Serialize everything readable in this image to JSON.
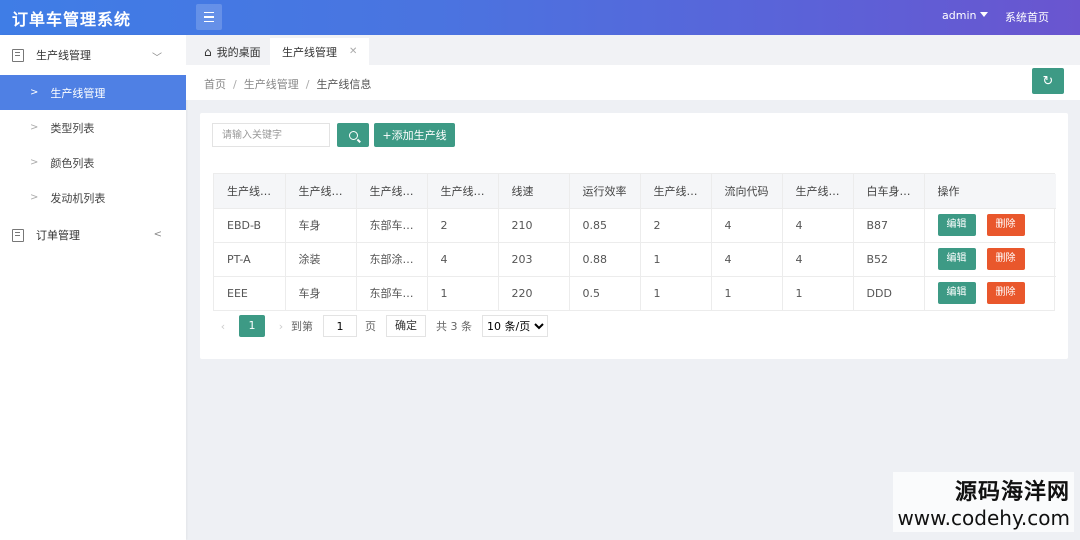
{
  "app": {
    "title": "订单车管理系统"
  },
  "header": {
    "user": "admin",
    "home_link": "系统首页"
  },
  "sidebar": {
    "groups": [
      {
        "label": "生产线管理",
        "expanded": true,
        "items": [
          {
            "label": "生产线管理",
            "active": true
          },
          {
            "label": "类型列表",
            "active": false
          },
          {
            "label": "颜色列表",
            "active": false
          },
          {
            "label": "发动机列表",
            "active": false
          }
        ]
      },
      {
        "label": "订单管理",
        "expanded": false,
        "items": []
      }
    ]
  },
  "tabs": [
    {
      "label": "我的桌面",
      "icon": "home-icon"
    },
    {
      "label": "生产线管理",
      "closable": true
    }
  ],
  "breadcrumb": [
    "首页",
    "生产线管理",
    "生产线信息"
  ],
  "toolbar": {
    "search_placeholder": "请输入关键字",
    "add_label": "+添加生产线"
  },
  "table": {
    "headers": [
      "生产线…",
      "生产线…",
      "生产线…",
      "生产线…",
      "线速",
      "运行效率",
      "生产线…",
      "流向代码",
      "生产线…",
      "白车身…",
      "操作"
    ],
    "rows": [
      [
        "EBD-B",
        "车身",
        "东部车…",
        "2",
        "210",
        "0.85",
        "2",
        "4",
        "4",
        "B87"
      ],
      [
        "PT-A",
        "涂装",
        "东部涂…",
        "4",
        "203",
        "0.88",
        "1",
        "4",
        "4",
        "B52"
      ],
      [
        "EEE",
        "车身",
        "东部车…",
        "1",
        "220",
        "0.5",
        "1",
        "1",
        "1",
        "DDD"
      ]
    ],
    "edit_label": "编辑",
    "delete_label": "删除"
  },
  "pagination": {
    "current_page": "1",
    "goto_prefix": "到第",
    "goto_value": "1",
    "goto_suffix": "页",
    "confirm_label": "确定",
    "total_label": "共 3 条",
    "page_size": "10 条/页"
  },
  "watermark": {
    "name": "源码海洋网",
    "url": "www.codehy.com"
  },
  "colors": {
    "primary": "#3d9a85",
    "danger": "#e9572c",
    "nav_active": "#4f80e4",
    "header_start": "#3f7de6",
    "header_end": "#6a55cf"
  }
}
